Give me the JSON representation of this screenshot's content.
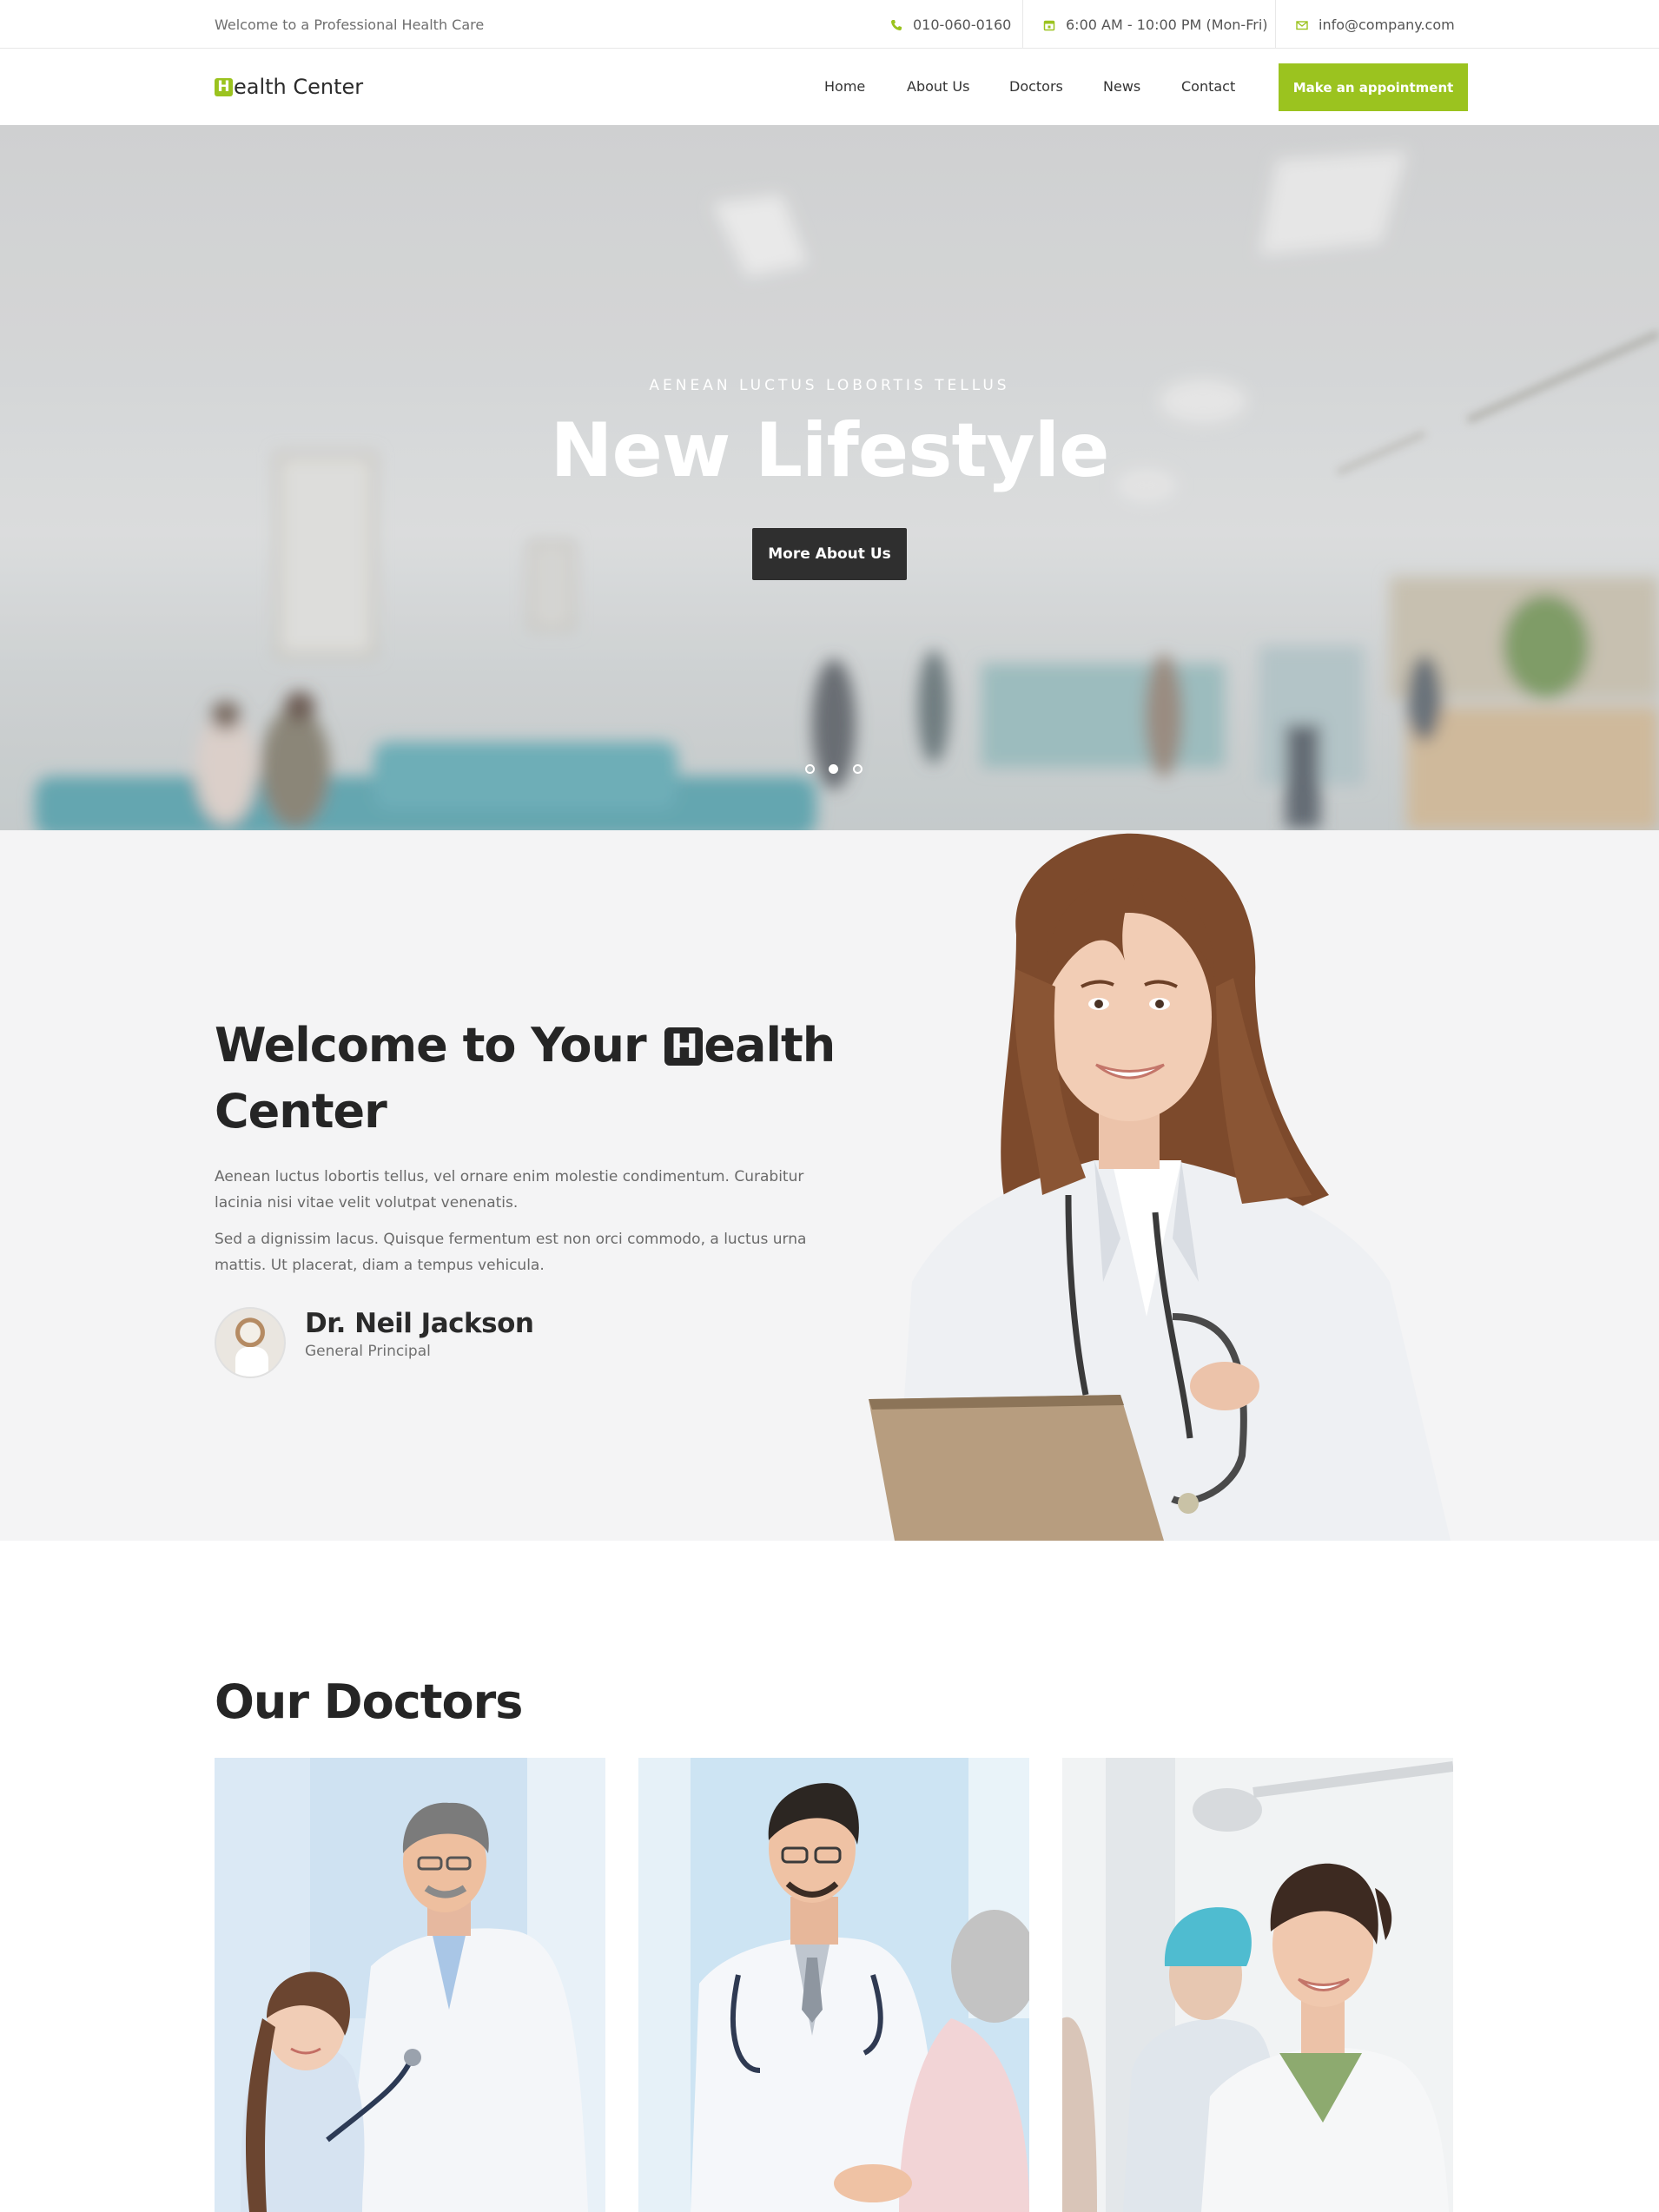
{
  "topbar": {
    "welcome": "Welcome to a Professional Health Care",
    "phone": "010-060-0160",
    "hours": "6:00 AM - 10:00 PM (Mon-Fri)",
    "email": "info@company.com",
    "phone_icon": "phone-icon",
    "hours_icon": "calendar-icon",
    "email_icon": "envelope-icon"
  },
  "brand": {
    "logo_letter": "H",
    "logo_rest": "ealth Center",
    "accent": "#9bc31f"
  },
  "nav": {
    "items": [
      {
        "label": "Home"
      },
      {
        "label": "About Us"
      },
      {
        "label": "Doctors"
      },
      {
        "label": "News"
      },
      {
        "label": "Contact"
      }
    ],
    "cta": "Make an appointment"
  },
  "hero": {
    "kicker": "AENEAN LUCTUS LOBORTIS TELLUS",
    "title": "New Lifestyle",
    "button": "More About Us",
    "slides": 3,
    "active_slide": 2
  },
  "welcome": {
    "title_part1": "Welcome to Your ",
    "title_letter": "H",
    "title_part2": "ealth Center",
    "para1": "Aenean luctus lobortis tellus, vel ornare enim molestie condimentum. Curabitur lacinia nisi vitae velit volutpat venenatis.",
    "para2": "Sed a dignissim lacus. Quisque fermentum est non orci commodo, a luctus urna mattis. Ut placerat, diam a tempus vehicula.",
    "doctor_name": "Dr. Neil Jackson",
    "doctor_role": "General Principal"
  },
  "doctors": {
    "title": "Our Doctors"
  }
}
